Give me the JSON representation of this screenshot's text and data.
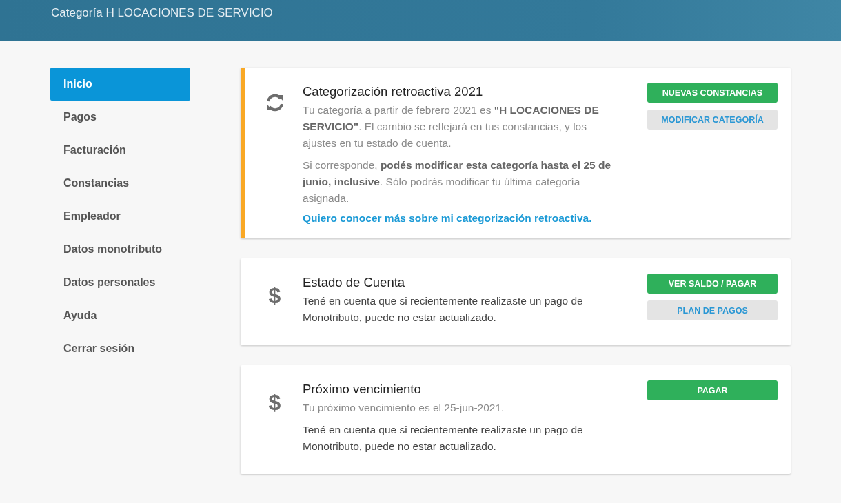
{
  "header": {
    "title": "Categoría H LOCACIONES DE SERVICIO"
  },
  "sidebar": {
    "items": [
      {
        "label": "Inicio",
        "selected": true
      },
      {
        "label": "Pagos",
        "selected": false
      },
      {
        "label": "Facturación",
        "selected": false
      },
      {
        "label": "Constancias",
        "selected": false
      },
      {
        "label": "Empleador",
        "selected": false
      },
      {
        "label": "Datos monotributo",
        "selected": false
      },
      {
        "label": "Datos personales",
        "selected": false
      },
      {
        "label": "Ayuda",
        "selected": false
      },
      {
        "label": "Cerrar sesión",
        "selected": false
      }
    ]
  },
  "cards": [
    {
      "kind": "refresh",
      "highlighted": true,
      "title": "Categorización retroactiva 2021",
      "paragraphs": [
        {
          "kind": "muted",
          "text": "Tu categoría a partir de febrero 2021 es **\"H LOCACIONES DE SERVICIO\"**. El cambio se reflejará en tus constancias, y los ajustes en tu estado de cuenta."
        },
        {
          "kind": "muted",
          "text": "Si corresponde, **podés modificar esta categoría hasta el 25 de junio, inclusive**. Sólo podrás modificar tu última categoría asignada."
        }
      ],
      "link": "Quiero conocer más sobre mi categorización retroactiva.",
      "buttons": [
        {
          "kind": "primary",
          "label": "NUEVAS CONSTANCIAS"
        },
        {
          "kind": "secondary",
          "label": "MODIFICAR CATEGORÍA"
        }
      ]
    },
    {
      "kind": "currency",
      "symbol": "$",
      "highlighted": false,
      "title": "Estado de Cuenta",
      "paragraphs": [
        {
          "kind": "normal",
          "text": "Tené en cuenta que si recientemente realizaste un pago de Monotributo, puede no estar actualizado."
        }
      ],
      "buttons": [
        {
          "kind": "primary",
          "label": "VER SALDO / PAGAR"
        },
        {
          "kind": "secondary",
          "label": "PLAN DE PAGOS"
        }
      ]
    },
    {
      "kind": "currency",
      "symbol": "$",
      "highlighted": false,
      "title": "Próximo vencimiento",
      "paragraphs": [
        {
          "kind": "muted",
          "text": "Tu próximo vencimiento es el 25-jun-2021."
        },
        {
          "kind": "normal",
          "text": "Tené en cuenta que si recientemente realizaste un pago de Monotributo, puede no estar actualizado."
        }
      ],
      "buttons": [
        {
          "kind": "primary",
          "label": "PAGAR"
        }
      ]
    }
  ]
}
